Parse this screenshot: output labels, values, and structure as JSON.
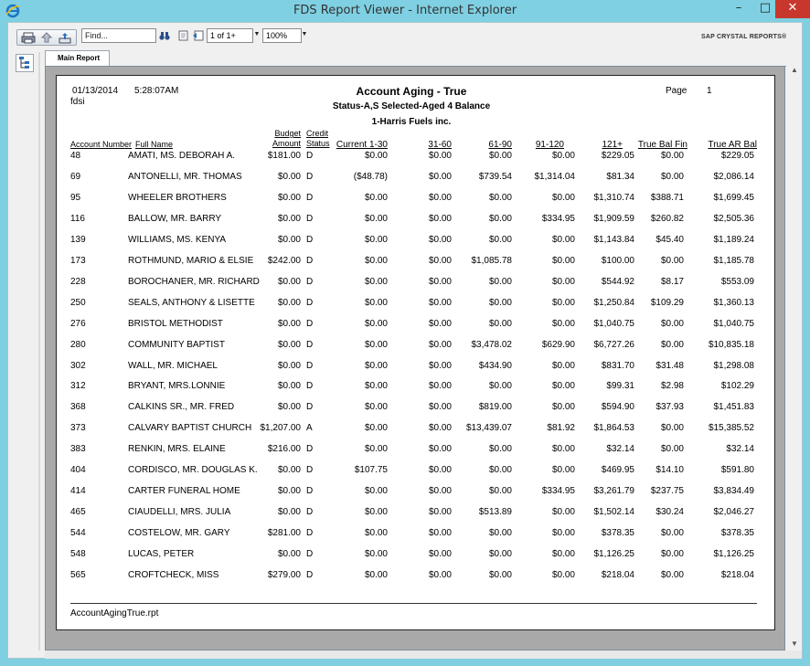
{
  "window": {
    "title": "FDS Report Viewer - Internet Explorer",
    "minimize": "–",
    "maximize": "□",
    "close": "✕"
  },
  "toolbar": {
    "find_placeholder": "Find...",
    "page_value": "1 of 1+",
    "zoom_value": "100%",
    "brand": "SAP CRYSTAL REPORTS®"
  },
  "tabs": [
    {
      "label": "Main Report"
    }
  ],
  "report": {
    "date": "01/13/2014",
    "time": "5:28:07AM",
    "user": "fdsi",
    "title": "Account Aging - True",
    "subtitle": "Status-A,S Selected-Aged 4 Balance",
    "company": "1-Harris Fuels inc.",
    "page_label": "Page",
    "page_number": "1",
    "footer": "AccountAgingTrue.rpt",
    "columns": {
      "account_number": "Account Number",
      "full_name": "Full Name",
      "budget_1": "Budget",
      "budget_2": "Amount",
      "credit_1": "Credit",
      "credit_2": "Status",
      "current": "Current 1-30",
      "d31": "31-60",
      "d61": "61-90",
      "d91": "91-120",
      "d121": "121+",
      "bal_fin": "True Bal Fin",
      "ar_bal": "True AR Bal"
    },
    "rows": [
      [
        "48",
        "AMATI, MS. DEBORAH A.",
        "$181.00",
        "D",
        "$0.00",
        "$0.00",
        "$0.00",
        "$0.00",
        "$229.05",
        "$0.00",
        "$229.05"
      ],
      [
        "69",
        "ANTONELLI, MR. THOMAS",
        "$0.00",
        "D",
        "($48.78)",
        "$0.00",
        "$739.54",
        "$1,314.04",
        "$81.34",
        "$0.00",
        "$2,086.14"
      ],
      [
        "95",
        "WHEELER BROTHERS",
        "$0.00",
        "D",
        "$0.00",
        "$0.00",
        "$0.00",
        "$0.00",
        "$1,310.74",
        "$388.71",
        "$1,699.45"
      ],
      [
        "116",
        "BALLOW, MR. BARRY",
        "$0.00",
        "D",
        "$0.00",
        "$0.00",
        "$0.00",
        "$334.95",
        "$1,909.59",
        "$260.82",
        "$2,505.36"
      ],
      [
        "139",
        "WILLIAMS, MS. KENYA",
        "$0.00",
        "D",
        "$0.00",
        "$0.00",
        "$0.00",
        "$0.00",
        "$1,143.84",
        "$45.40",
        "$1,189.24"
      ],
      [
        "173",
        "ROTHMUND, MARIO & ELSIE",
        "$242.00",
        "D",
        "$0.00",
        "$0.00",
        "$1,085.78",
        "$0.00",
        "$100.00",
        "$0.00",
        "$1,185.78"
      ],
      [
        "228",
        "BOROCHANER, MR. RICHARD",
        "$0.00",
        "D",
        "$0.00",
        "$0.00",
        "$0.00",
        "$0.00",
        "$544.92",
        "$8.17",
        "$553.09"
      ],
      [
        "250",
        "SEALS, ANTHONY & LISETTE",
        "$0.00",
        "D",
        "$0.00",
        "$0.00",
        "$0.00",
        "$0.00",
        "$1,250.84",
        "$109.29",
        "$1,360.13"
      ],
      [
        "276",
        "BRISTOL METHODIST",
        "$0.00",
        "D",
        "$0.00",
        "$0.00",
        "$0.00",
        "$0.00",
        "$1,040.75",
        "$0.00",
        "$1,040.75"
      ],
      [
        "280",
        "COMMUNITY BAPTIST",
        "$0.00",
        "D",
        "$0.00",
        "$0.00",
        "$3,478.02",
        "$629.90",
        "$6,727.26",
        "$0.00",
        "$10,835.18"
      ],
      [
        "302",
        "WALL, MR. MICHAEL",
        "$0.00",
        "D",
        "$0.00",
        "$0.00",
        "$434.90",
        "$0.00",
        "$831.70",
        "$31.48",
        "$1,298.08"
      ],
      [
        "312",
        "BRYANT, MRS.LONNIE",
        "$0.00",
        "D",
        "$0.00",
        "$0.00",
        "$0.00",
        "$0.00",
        "$99.31",
        "$2.98",
        "$102.29"
      ],
      [
        "368",
        "CALKINS SR., MR. FRED",
        "$0.00",
        "D",
        "$0.00",
        "$0.00",
        "$819.00",
        "$0.00",
        "$594.90",
        "$37.93",
        "$1,451.83"
      ],
      [
        "373",
        "CALVARY BAPTIST CHURCH",
        "$1,207.00",
        "A",
        "$0.00",
        "$0.00",
        "$13,439.07",
        "$81.92",
        "$1,864.53",
        "$0.00",
        "$15,385.52"
      ],
      [
        "383",
        "RENKIN, MRS. ELAINE",
        "$216.00",
        "D",
        "$0.00",
        "$0.00",
        "$0.00",
        "$0.00",
        "$32.14",
        "$0.00",
        "$32.14"
      ],
      [
        "404",
        "CORDISCO, MR. DOUGLAS K.",
        "$0.00",
        "D",
        "$107.75",
        "$0.00",
        "$0.00",
        "$0.00",
        "$469.95",
        "$14.10",
        "$591.80"
      ],
      [
        "414",
        "CARTER FUNERAL HOME",
        "$0.00",
        "D",
        "$0.00",
        "$0.00",
        "$0.00",
        "$334.95",
        "$3,261.79",
        "$237.75",
        "$3,834.49"
      ],
      [
        "465",
        "CIAUDELLI, MRS. JULIA",
        "$0.00",
        "D",
        "$0.00",
        "$0.00",
        "$513.89",
        "$0.00",
        "$1,502.14",
        "$30.24",
        "$2,046.27"
      ],
      [
        "544",
        "COSTELOW, MR. GARY",
        "$281.00",
        "D",
        "$0.00",
        "$0.00",
        "$0.00",
        "$0.00",
        "$378.35",
        "$0.00",
        "$378.35"
      ],
      [
        "548",
        "LUCAS, PETER",
        "$0.00",
        "D",
        "$0.00",
        "$0.00",
        "$0.00",
        "$0.00",
        "$1,126.25",
        "$0.00",
        "$1,126.25"
      ],
      [
        "565",
        "CROFTCHECK, MISS",
        "$279.00",
        "D",
        "$0.00",
        "$0.00",
        "$0.00",
        "$0.00",
        "$218.04",
        "$0.00",
        "$218.04"
      ]
    ]
  }
}
